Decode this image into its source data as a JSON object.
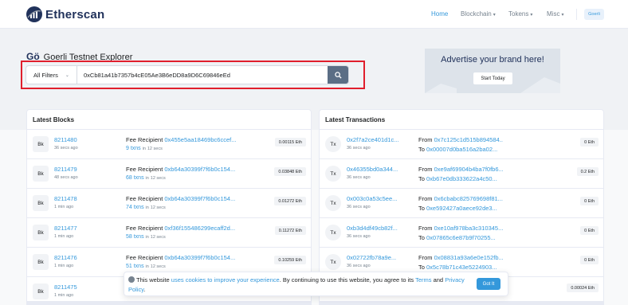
{
  "header": {
    "logo_text": "Etherscan",
    "nav": {
      "home": "Home",
      "blockchain": "Blockchain",
      "tokens": "Tokens",
      "misc": "Misc"
    },
    "network_button": "Goerli",
    "accent": "#3498db"
  },
  "hero": {
    "mark": "Gö",
    "title": "Goerli Testnet Explorer",
    "search": {
      "filter": "All Filters",
      "query": "0xCb81a41b7357b4cE05Ae3B6eDD8a9D6C69846eEd"
    },
    "ad": {
      "title": "Advertise your brand here!",
      "button": "Start Today"
    }
  },
  "blocks": {
    "title": "Latest Blocks",
    "icon_label": "Bk",
    "recipient_label": "Fee Recipient",
    "in_label": "in",
    "rows": [
      {
        "number": "8211480",
        "ago": "36 secs ago",
        "recipient": "0x455e5aa18469bc6ccef...",
        "txns": "9 txns",
        "time": "12 secs",
        "reward": "0.00115 Eth"
      },
      {
        "number": "8211479",
        "ago": "48 secs ago",
        "recipient": "0xb64a30399f7f6b0c154...",
        "txns": "68 txns",
        "time": "12 secs",
        "reward": "0.03848 Eth"
      },
      {
        "number": "8211478",
        "ago": "1 min ago",
        "recipient": "0xb64a30399f7f6b0c154...",
        "txns": "74 txns",
        "time": "12 secs",
        "reward": "0.01272 Eth"
      },
      {
        "number": "8211477",
        "ago": "1 min ago",
        "recipient": "0xf36f155486299ecaff2d...",
        "txns": "58 txns",
        "time": "12 secs",
        "reward": "0.11272 Eth"
      },
      {
        "number": "8211476",
        "ago": "1 min ago",
        "recipient": "0xb64a30399f7f6b0c154...",
        "txns": "51 txns",
        "time": "12 secs",
        "reward": "0.10259 Eth"
      },
      {
        "number": "8211475",
        "ago": "1 min ago",
        "recipient": "",
        "txns": "",
        "time": "",
        "reward": ""
      }
    ]
  },
  "transactions": {
    "title": "Latest Transactions",
    "icon_label": "Tx",
    "from_label": "From",
    "to_label": "To",
    "rows": [
      {
        "hash": "0x2f7a2ce401d1c...",
        "ago": "36 secs ago",
        "from": "0x7c125c1d515b894584...",
        "to": "0x00007d0ba516a2ba02...",
        "value": "0 Eth"
      },
      {
        "hash": "0x46355bd0a344...",
        "ago": "36 secs ago",
        "from": "0xe9af69904b4ba7f0fb6...",
        "to": "0xb67e0db333622a4c50...",
        "value": "0.2 Eth"
      },
      {
        "hash": "0x003c0a53c5ee...",
        "ago": "36 secs ago",
        "from": "0x6cbabc825769698f81...",
        "to": "0xe592427a0aece92de3...",
        "value": "0 Eth"
      },
      {
        "hash": "0xb3d4df49cb82f...",
        "ago": "36 secs ago",
        "from": "0xe10af978ba3c310345...",
        "to": "0x07865c6e87b9f70255...",
        "value": "0 Eth"
      },
      {
        "hash": "0x02722fb78a9e...",
        "ago": "36 secs ago",
        "from": "0x08831a93a6e0e152fb...",
        "to": "0x5c78b71c43e5224903...",
        "value": "0 Eth"
      },
      {
        "hash": "",
        "ago": "",
        "from": "",
        "to": "",
        "value": "0.00024 Eth"
      }
    ]
  },
  "cookie": {
    "text1": "This website",
    "link1": "uses cookies to improve your experience",
    "text2": ". By continuing to use this website, you agree to its",
    "link2": "Terms",
    "text3": "and",
    "link3": "Privacy Policy",
    "text4": ".",
    "button": "Got It"
  }
}
